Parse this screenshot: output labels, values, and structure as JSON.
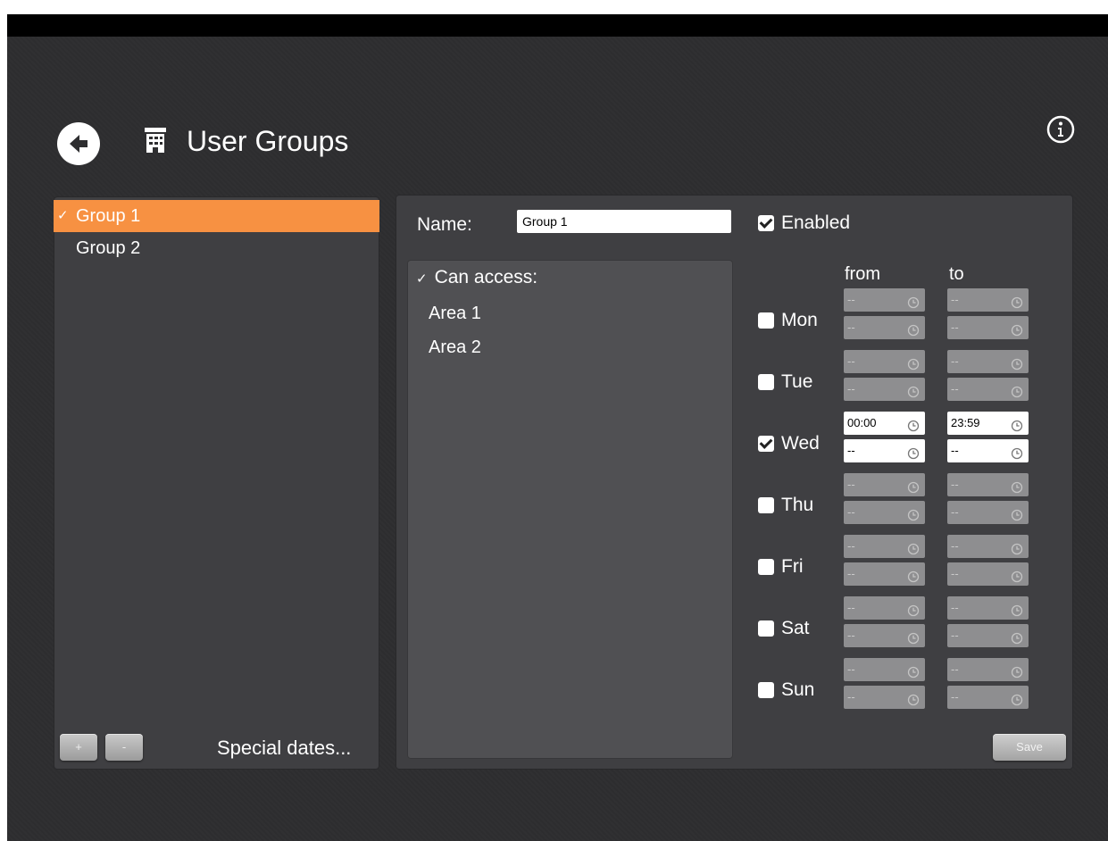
{
  "header": {
    "title": "User Groups",
    "back_icon": "back-arrow-icon",
    "title_icon": "building-icon",
    "info_icon": "info-icon"
  },
  "groups": {
    "items": [
      {
        "label": "Group 1",
        "selected": true
      },
      {
        "label": "Group 2",
        "selected": false
      }
    ],
    "add_label": "+",
    "remove_label": "-",
    "special_dates_label": "Special dates..."
  },
  "detail": {
    "name_label": "Name:",
    "name_value": "Group 1",
    "enabled_label": "Enabled",
    "enabled": true,
    "access_header": "Can access:",
    "areas": [
      "Area 1",
      "Area 2"
    ],
    "from_label": "from",
    "to_label": "to",
    "days": [
      {
        "label": "Mon",
        "checked": false,
        "from": [
          "--",
          "--"
        ],
        "to": [
          "--",
          "--"
        ]
      },
      {
        "label": "Tue",
        "checked": false,
        "from": [
          "--",
          "--"
        ],
        "to": [
          "--",
          "--"
        ]
      },
      {
        "label": "Wed",
        "checked": true,
        "from": [
          "00:00",
          "--"
        ],
        "to": [
          "23:59",
          "--"
        ]
      },
      {
        "label": "Thu",
        "checked": false,
        "from": [
          "--",
          "--"
        ],
        "to": [
          "--",
          "--"
        ]
      },
      {
        "label": "Fri",
        "checked": false,
        "from": [
          "--",
          "--"
        ],
        "to": [
          "--",
          "--"
        ]
      },
      {
        "label": "Sat",
        "checked": false,
        "from": [
          "--",
          "--"
        ],
        "to": [
          "--",
          "--"
        ]
      },
      {
        "label": "Sun",
        "checked": false,
        "from": [
          "--",
          "--"
        ],
        "to": [
          "--",
          "--"
        ]
      }
    ],
    "save_label": "Save"
  },
  "colors": {
    "accent": "#f79142",
    "background": "#2e2e30",
    "panel": "#3f3f42"
  }
}
